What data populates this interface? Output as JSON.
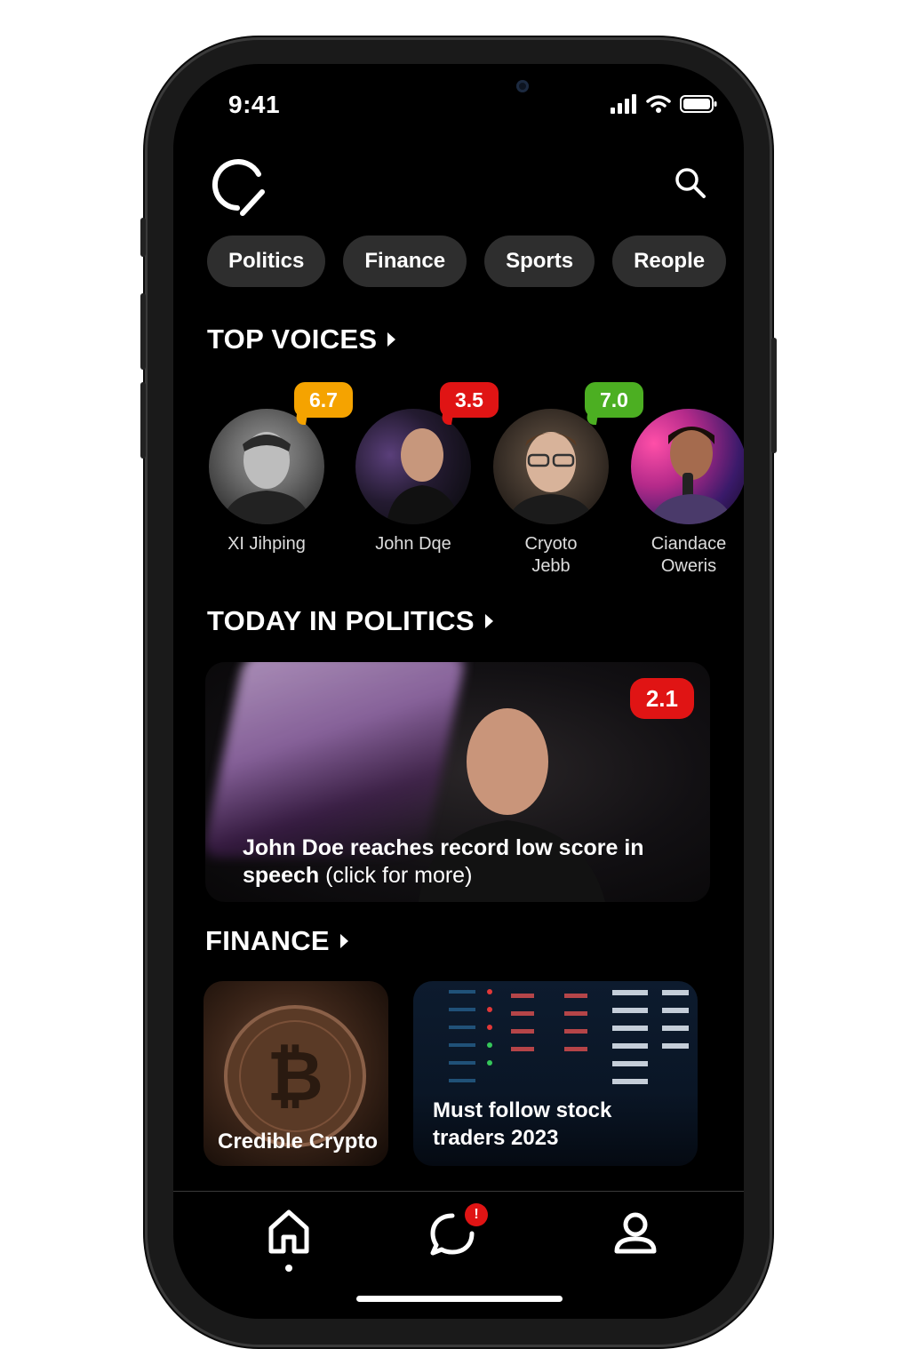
{
  "status_bar": {
    "time": "9:41"
  },
  "header": {
    "logo_icon": "app-logo-icon",
    "search_icon": "search-icon"
  },
  "categories": [
    {
      "label": "Politics"
    },
    {
      "label": "Finance"
    },
    {
      "label": "Sports"
    },
    {
      "label": "Reople"
    }
  ],
  "top_voices": {
    "title": "TOP VOICES",
    "people": [
      {
        "name": "XI Jihping",
        "score": "6.7",
        "score_color": "#f5a300"
      },
      {
        "name": "John Dqe",
        "score": "3.5",
        "score_color": "#e01414"
      },
      {
        "name": "Cryoto Jebb",
        "name_line1": "Cryoto",
        "name_line2": "Jebb",
        "score": "7.0",
        "score_color": "#4caf22"
      },
      {
        "name": "Ciandace Oweris",
        "name_line1": "Ciandace",
        "name_line2": "Oweris",
        "score": "",
        "score_color": ""
      }
    ]
  },
  "politics": {
    "title": "TODAY IN POLITICS",
    "headline": "John Doe reaches record low score in speech",
    "more": "(click for more)",
    "score": "2.1"
  },
  "finance": {
    "title": "FINANCE",
    "cards": [
      {
        "label": "Credible Crypto"
      },
      {
        "label_line1": "Must follow stock",
        "label_line2": "traders 2023"
      }
    ]
  },
  "tabbar": {
    "notification_count": "!"
  },
  "colors": {
    "accent": "#e01414",
    "chip_bg": "#2e2e2e",
    "background": "#000000"
  }
}
